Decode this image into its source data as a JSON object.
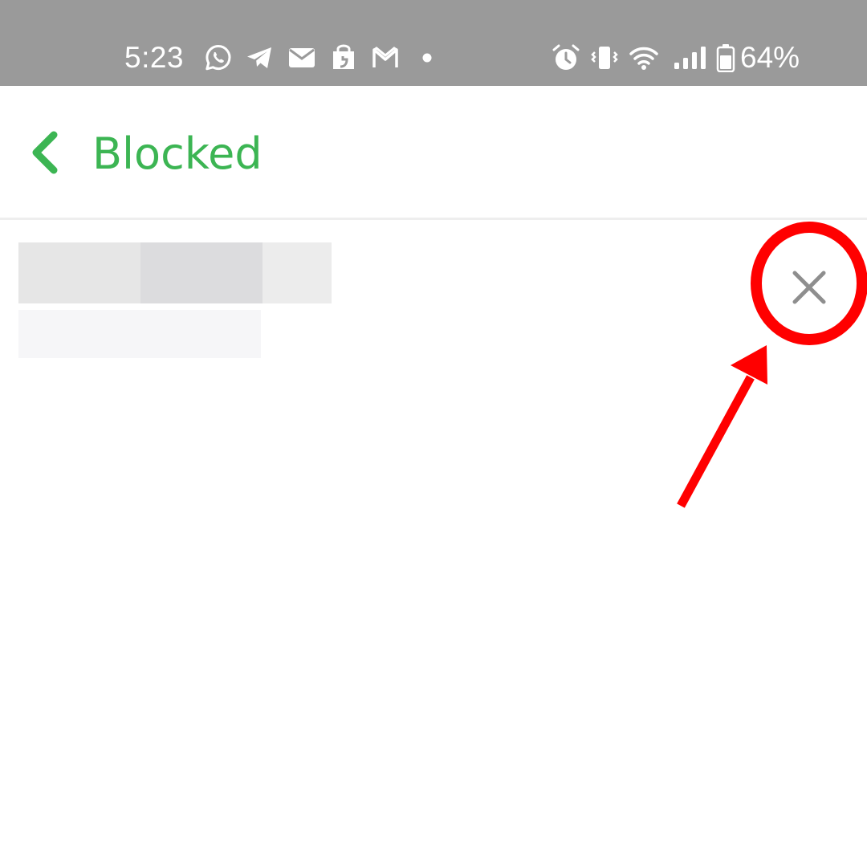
{
  "status_bar": {
    "time": "5:23",
    "battery_percent_text": "64%",
    "background_color": "#9a9a9a",
    "notification_icons": [
      "whatsapp-icon",
      "telegram-icon",
      "mail-icon",
      "shopping-bag-icon",
      "gmail-icon",
      "more-dot-icon"
    ],
    "system_icons": [
      "alarm-icon",
      "vibrate-icon",
      "wifi-icon",
      "signal-icon",
      "battery-icon"
    ]
  },
  "header": {
    "title": "Blocked",
    "back_icon": "chevron-left-icon",
    "accent_color": "#3cb553"
  },
  "blocked_list": {
    "items": [
      {
        "name_redacted": true,
        "subtitle_redacted": true,
        "action_icon": "close-icon"
      }
    ]
  },
  "annotation": {
    "highlight": "red-circle",
    "pointer": "red-arrow",
    "color": "#ff0000"
  }
}
